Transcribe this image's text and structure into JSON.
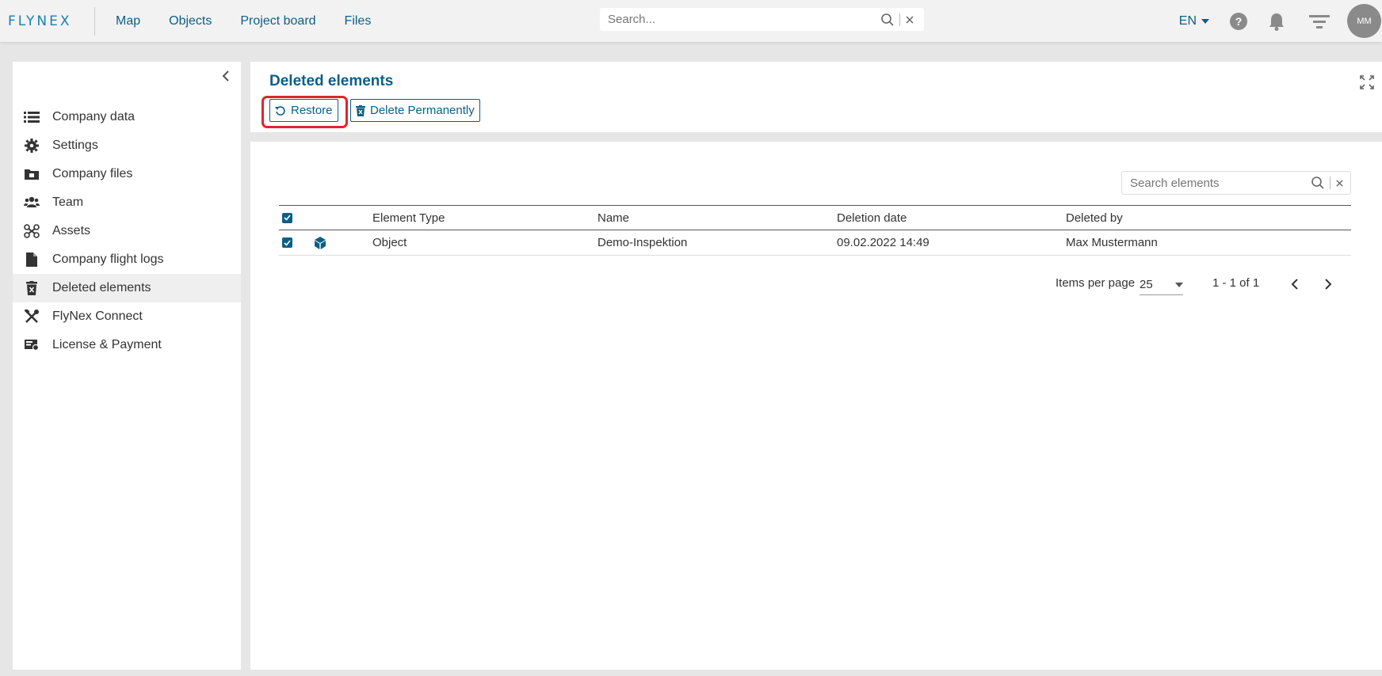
{
  "topbar": {
    "logo_text": "FLYNEX",
    "nav": [
      "Map",
      "Objects",
      "Project board",
      "Files"
    ],
    "search_placeholder": "Search...",
    "language": "EN",
    "avatar_initials": "MM"
  },
  "sidebar": {
    "items": [
      {
        "label": "Company data",
        "icon": "list-icon"
      },
      {
        "label": "Settings",
        "icon": "gear-icon"
      },
      {
        "label": "Company files",
        "icon": "folder-icon"
      },
      {
        "label": "Team",
        "icon": "team-icon"
      },
      {
        "label": "Assets",
        "icon": "drone-icon"
      },
      {
        "label": "Company flight logs",
        "icon": "file-icon"
      },
      {
        "label": "Deleted elements",
        "icon": "trash-icon",
        "active": true
      },
      {
        "label": "FlyNex Connect",
        "icon": "tools-icon"
      },
      {
        "label": "License & Payment",
        "icon": "license-icon"
      }
    ]
  },
  "panel": {
    "title": "Deleted elements",
    "restore_label": "Restore",
    "delete_label": "Delete Permanently",
    "search_placeholder": "Search elements"
  },
  "table": {
    "headers": [
      "Element Type",
      "Name",
      "Deletion date",
      "Deleted by"
    ],
    "rows": [
      {
        "type": "Object",
        "name": "Demo-Inspektion",
        "date": "09.02.2022 14:49",
        "by": "Max Mustermann",
        "checked": true
      }
    ]
  },
  "pagination": {
    "items_per_page_label": "Items per page",
    "items_per_page": "25",
    "range": "1 - 1 of 1"
  },
  "colors": {
    "accent": "#0b5f86",
    "highlight": "#e1242b"
  }
}
